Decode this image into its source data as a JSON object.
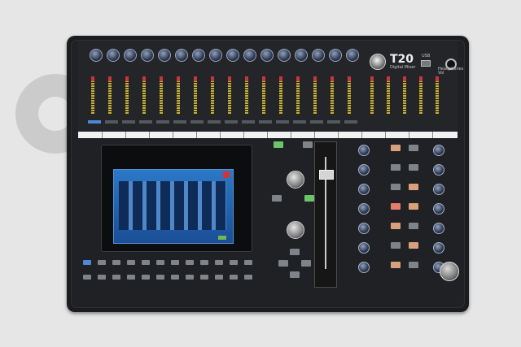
{
  "device": {
    "title": "T20",
    "subtitle": "Digital Mixer",
    "usb_label": "USB",
    "phones_label": "Headphones Vol",
    "colors": {
      "background": "#e6e6e6",
      "body": "#1b1c1e",
      "accent_blue": "#4f86d6",
      "accent_red": "#d2323a",
      "meter_yellow": "#c7b12f"
    }
  }
}
